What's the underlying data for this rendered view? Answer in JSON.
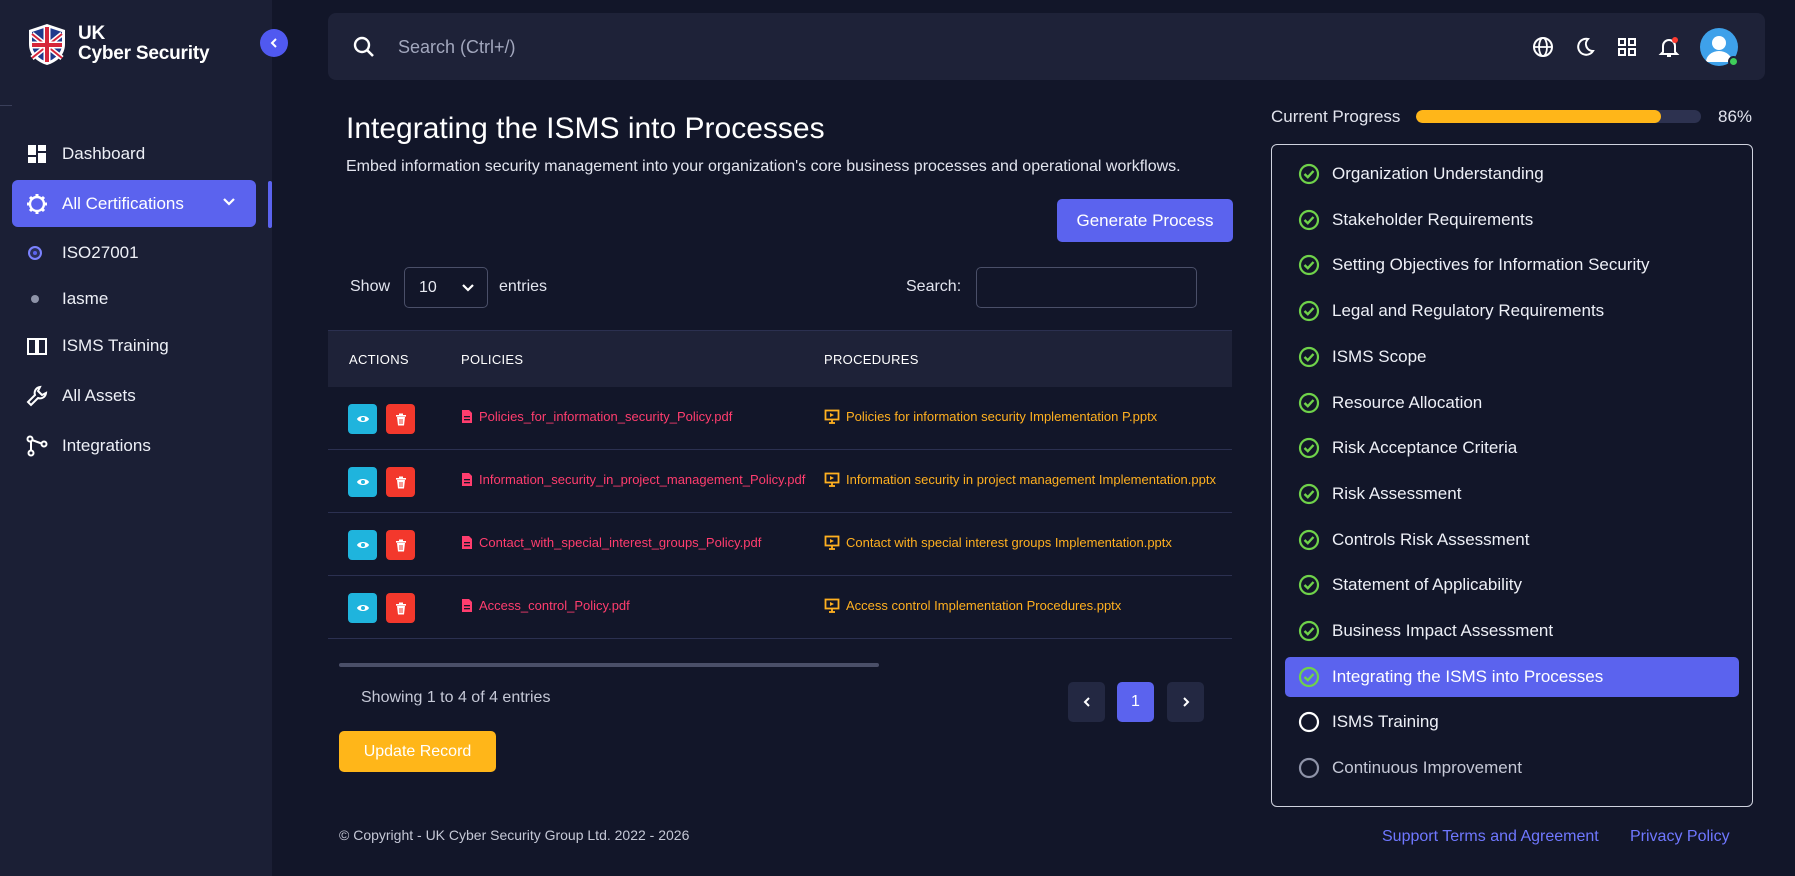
{
  "brand": {
    "line1": "UK",
    "line2": "Cyber Security"
  },
  "nav": {
    "dashboard": "Dashboard",
    "all_certifications": "All Certifications",
    "sub_iso": "ISO27001",
    "sub_iasme": "Iasme",
    "isms_training": "ISMS Training",
    "all_assets": "All Assets",
    "integrations": "Integrations"
  },
  "topbar": {
    "search_placeholder": "Search (Ctrl+/)"
  },
  "page": {
    "title": "Integrating the ISMS into Processes",
    "subtitle": "Embed information security management into your organization's core business processes and operational workflows.",
    "generate_label": "Generate Process"
  },
  "table_controls": {
    "show": "Show",
    "entries_value": "10",
    "entries": "entries",
    "search_label": "Search:"
  },
  "table": {
    "headers": {
      "actions": "ACTIONS",
      "policies": "POLICIES",
      "procedures": "PROCEDURES"
    },
    "rows": [
      {
        "policy": "Policies_for_information_security_Policy.pdf",
        "procedure": "Policies for information security Implementation P.pptx"
      },
      {
        "policy": "Information_security_in_project_management_Policy.pdf",
        "procedure": "Information security in project management Implementation.pptx"
      },
      {
        "policy": "Contact_with_special_interest_groups_Policy.pdf",
        "procedure": "Contact with special interest groups Implementation.pptx"
      },
      {
        "policy": "Access_control_Policy.pdf",
        "procedure": "Access control Implementation Procedures.pptx"
      }
    ]
  },
  "pagination": {
    "showing": "Showing 1 to 4 of 4 entries",
    "current_page": "1"
  },
  "update_label": "Update Record",
  "footer": {
    "copyright": "© Copyright - UK Cyber Security Group Ltd. 2022 - 2026",
    "support": "Support Terms and Agreement",
    "privacy": "Privacy Policy"
  },
  "progress": {
    "label": "Current Progress",
    "percent_text": "86%",
    "fraction": 0.86,
    "steps": [
      {
        "label": "Organization Understanding",
        "status": "done"
      },
      {
        "label": "Stakeholder Requirements",
        "status": "done"
      },
      {
        "label": "Setting Objectives for Information Security",
        "status": "done"
      },
      {
        "label": "Legal and Regulatory Requirements",
        "status": "done"
      },
      {
        "label": "ISMS Scope",
        "status": "done"
      },
      {
        "label": "Resource Allocation",
        "status": "done"
      },
      {
        "label": "Risk Acceptance Criteria",
        "status": "done"
      },
      {
        "label": "Risk Assessment",
        "status": "done"
      },
      {
        "label": "Controls Risk Assessment",
        "status": "done"
      },
      {
        "label": "Statement of Applicability",
        "status": "done"
      },
      {
        "label": "Business Impact Assessment",
        "status": "done"
      },
      {
        "label": "Integrating the ISMS into Processes",
        "status": "current"
      },
      {
        "label": "ISMS Training",
        "status": "todo"
      },
      {
        "label": "Continuous Improvement",
        "status": "todo"
      }
    ]
  },
  "colors": {
    "accent": "#5b63ee",
    "warning": "#ffb619",
    "success": "#6fd24a",
    "danger": "#f3382c",
    "info": "#1fb4dd"
  }
}
